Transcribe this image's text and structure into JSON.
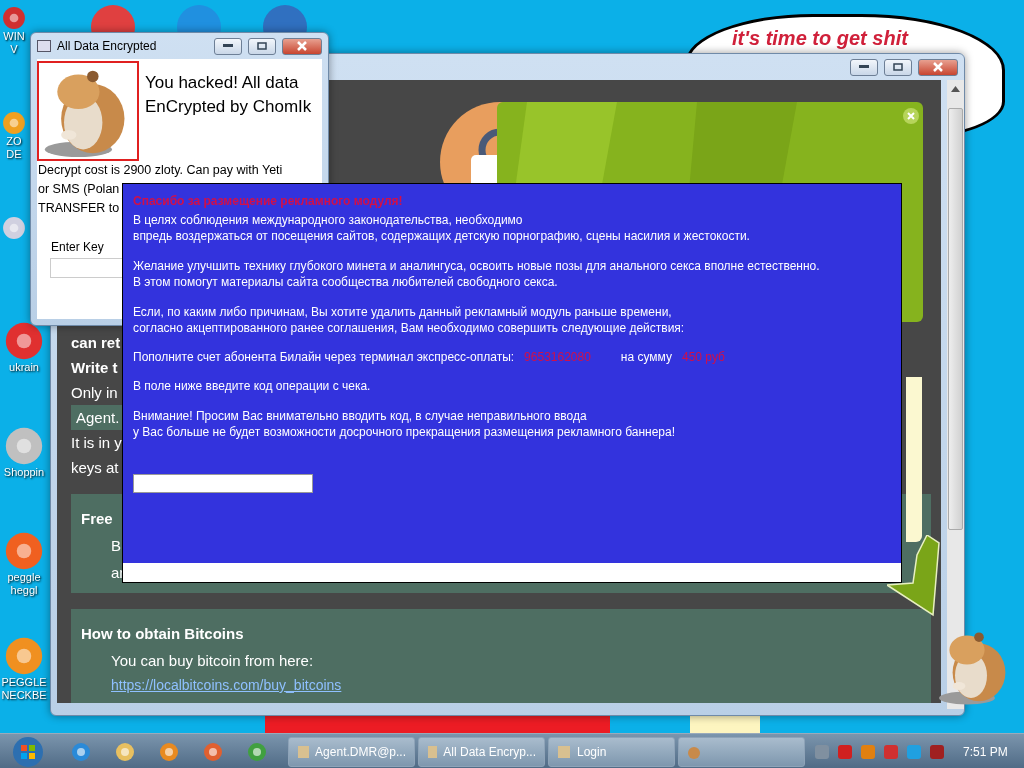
{
  "desktop_icons": [
    {
      "lines": [
        "WIN",
        "V"
      ]
    },
    {
      "lines": [
        "ZO",
        "DE"
      ]
    },
    {
      "lines": [
        "ukrain"
      ]
    },
    {
      "lines": [
        "Shoppin"
      ]
    },
    {
      "lines": [
        "peggle",
        "heggl"
      ]
    },
    {
      "lines": [
        "PEGGLE",
        "NECKBE"
      ]
    }
  ],
  "speech_bubble": {
    "text": "it's time to get shit"
  },
  "back_window": {
    "fragments": [
      {
        "kind": "bold",
        "text": "can ret"
      },
      {
        "kind": "bold",
        "text": "Write t"
      },
      {
        "kind": "plain",
        "text": "Only in"
      },
      {
        "kind": "tag",
        "text": "Agent."
      },
      {
        "kind": "plain",
        "text": "It is in y"
      },
      {
        "kind": "plain",
        "text": "keys at"
      }
    ],
    "panels": [
      {
        "title": "Free",
        "lines": [
          "B",
          "ar"
        ]
      },
      {
        "title": "How to obtain Bitcoins",
        "lines": [
          "You can buy bitcoin from here:"
        ],
        "link": "https://localbitcoins.com/buy_bitcoins"
      }
    ]
  },
  "ransom_window": {
    "title": "All Data Encrypted",
    "headline": [
      "You hacked! All data",
      "EnCrypted by ChomIk"
    ],
    "body": [
      "Decrypt cost is 2900 zloty. Can pay with Yeti",
      "or SMS (Polan",
      "TRANSFER to"
    ],
    "key_label": "Enter Key"
  },
  "blue_dialog": {
    "heading": "Спасибо за размещение рекламного модуля!",
    "paragraphs": [
      {
        "lines": [
          "В целях соблюдения международного законодательства, необходимо",
          "впредь воздержаться от посещения сайтов, содержащих детскую порнографию, сцены насилия и жестокости."
        ]
      },
      {
        "lines": [
          "Желание улучшить технику глубокого минета и аналингуса, освоить новые позы для анального секса вполне естественно.",
          "В этом помогут материалы сайта сообщества любителей свободного секса."
        ]
      },
      {
        "lines": [
          "Если, по каким либо причинам, Вы хотите удалить данный рекламный модуль раньше времени,",
          "согласно акцептированного ранее соглашения, Вам необходимо совершить следующие действия:"
        ]
      }
    ],
    "payment": {
      "text": "Пополните счет абонента Билайн через терминал экспресс-оплаты:",
      "number": "9653162080",
      "sum_label": "на сумму",
      "sum": "450 руб"
    },
    "after": [
      {
        "lines": [
          "В поле ниже введите код операции с чека."
        ]
      },
      {
        "lines": [
          "Внимание! Просим Вас внимательно вводить код, в случае неправильного ввода",
          "у Вас больше не будет возможности досрочного прекращения размещения рекламного баннера!"
        ]
      }
    ]
  },
  "taskbar": {
    "tasks": [
      {
        "label": "Agent.DMR@p..."
      },
      {
        "label": "All Data Encryp..."
      },
      {
        "label": "Login"
      }
    ],
    "clock": "7:51 PM"
  }
}
